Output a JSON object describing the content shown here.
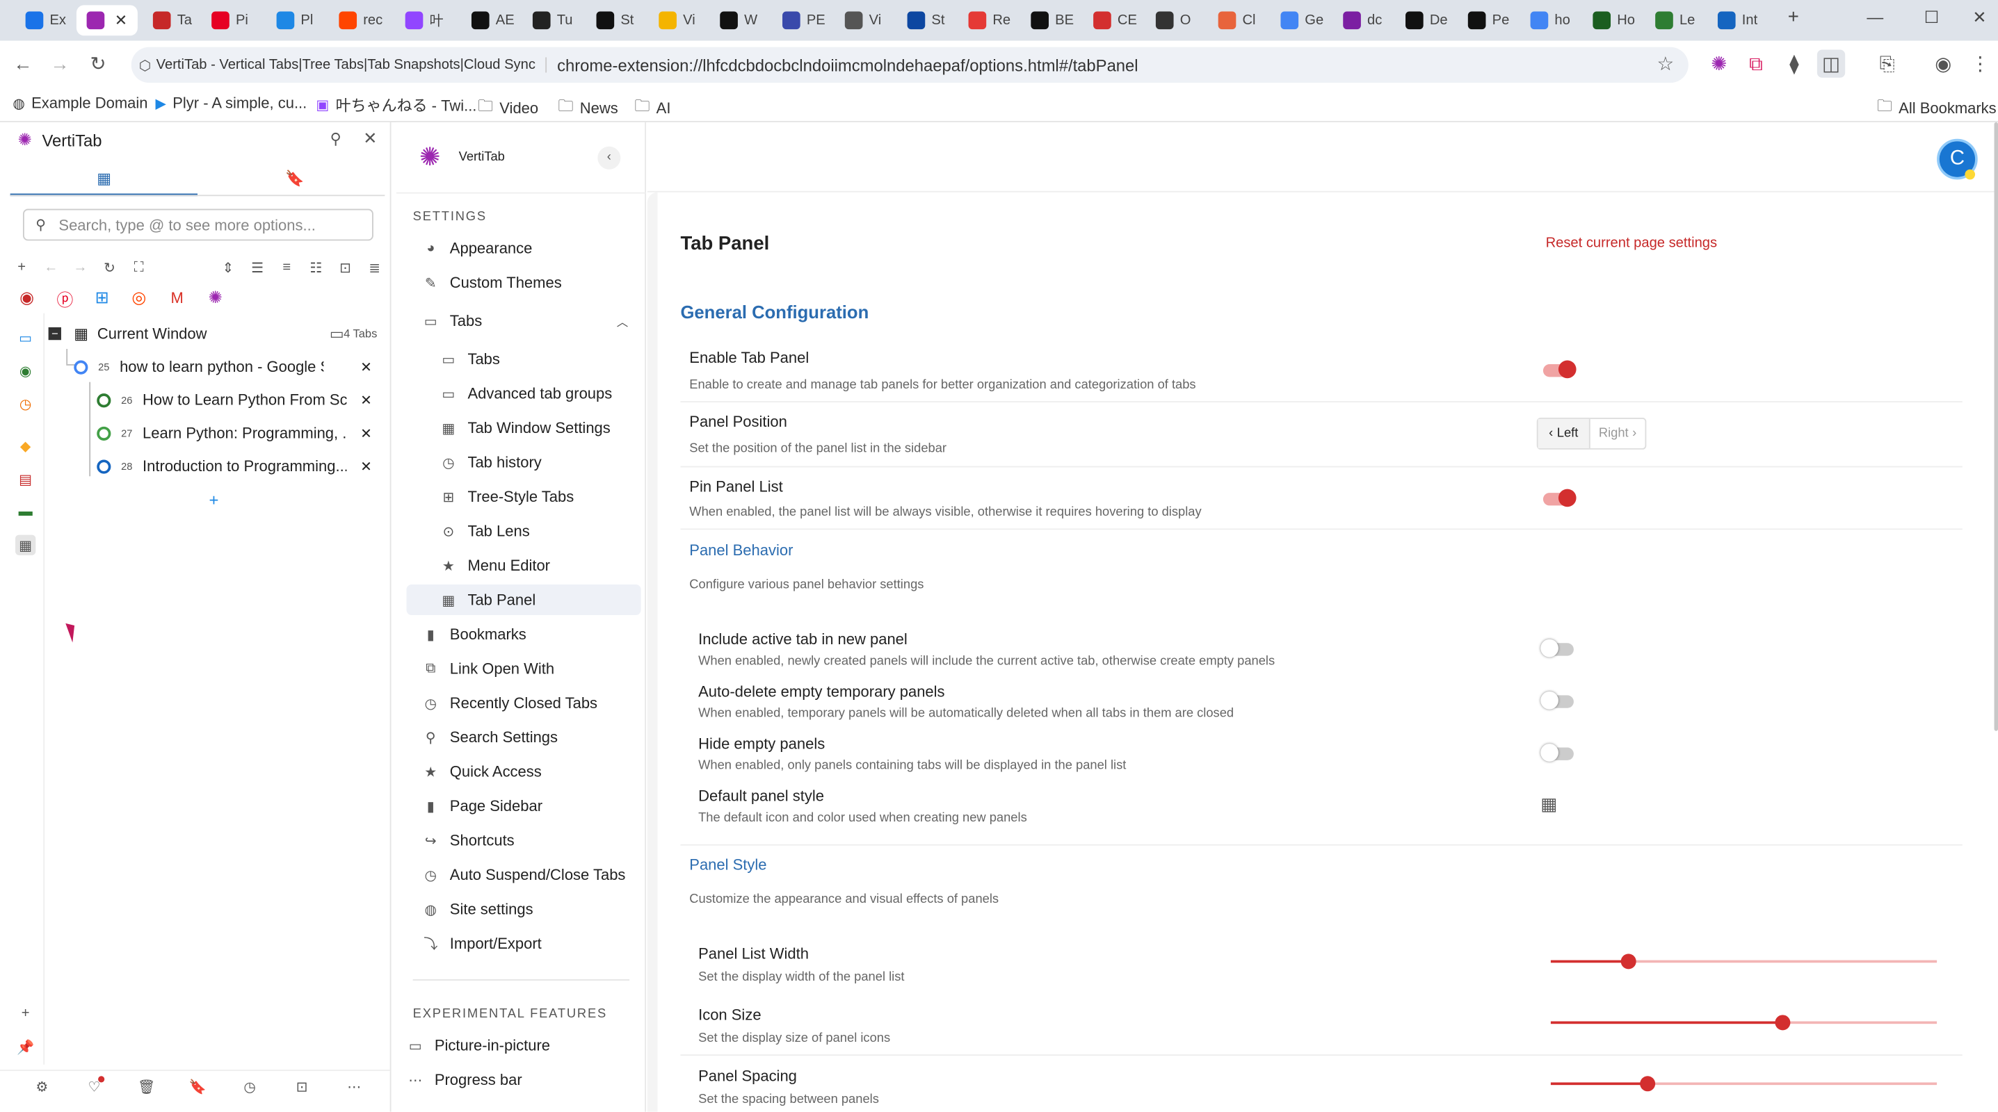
{
  "browser": {
    "tabs": [
      {
        "title": "Ex",
        "color": "#1a73e8"
      },
      {
        "title": "",
        "color": "#9c27b0",
        "active": true
      },
      {
        "title": "Ta",
        "color": "#c62828"
      },
      {
        "title": "Pi",
        "color": "#e60023"
      },
      {
        "title": "Pl",
        "color": "#1e88e5"
      },
      {
        "title": "rec",
        "color": "#ff4500"
      },
      {
        "title": "叶",
        "color": "#9146ff"
      },
      {
        "title": "AE",
        "color": "#111"
      },
      {
        "title": "Tu",
        "color": "#222"
      },
      {
        "title": "St",
        "color": "#111"
      },
      {
        "title": "Vi",
        "color": "#f4b400"
      },
      {
        "title": "W",
        "color": "#111"
      },
      {
        "title": "PE",
        "color": "#3949ab"
      },
      {
        "title": "Vi",
        "color": "#555"
      },
      {
        "title": "St",
        "color": "#0d47a1"
      },
      {
        "title": "Re",
        "color": "#e53935"
      },
      {
        "title": "BE",
        "color": "#111"
      },
      {
        "title": "CE",
        "color": "#d32f2f"
      },
      {
        "title": "O",
        "color": "#333"
      },
      {
        "title": "Cl",
        "color": "#e8643c"
      },
      {
        "title": "Ge",
        "color": "#4285f4"
      },
      {
        "title": "dc",
        "color": "#7b1fa2"
      },
      {
        "title": "De",
        "color": "#111"
      },
      {
        "title": "Pe",
        "color": "#111"
      },
      {
        "title": "ho",
        "color": "#4285f4"
      },
      {
        "title": "Ho",
        "color": "#1b5e20"
      },
      {
        "title": "Le",
        "color": "#2e7d32"
      },
      {
        "title": "Int",
        "color": "#1565c0"
      }
    ],
    "omnibox": {
      "site_chip": "VertiTab - Vertical Tabs|Tree Tabs|Tab Snapshots|Cloud Sync",
      "url": "chrome-extension://lhfcdcbdocbclndoiimcmolndehaepaf/options.html#/tabPanel"
    },
    "bookmarks": [
      "Example Domain",
      "Plyr - A simple, cu...",
      "叶ちゃんねる - Twi...",
      "Video",
      "News",
      "AI"
    ],
    "all_bookmarks": "All Bookmarks"
  },
  "sidepanel": {
    "title": "VertiTab",
    "search_placeholder": "Search, type @ to see more options...",
    "window_label": "Current Window",
    "tab_count": "4 Tabs",
    "tabs": [
      {
        "num": "25",
        "title": "how to learn python - Google Se...",
        "icon_color": "#4285f4"
      },
      {
        "num": "26",
        "title": "How to Learn Python From Sc...",
        "icon_color": "#2e7d32"
      },
      {
        "num": "27",
        "title": "Learn Python: Programming, ...",
        "icon_color": "#43a047"
      },
      {
        "num": "28",
        "title": "Introduction to Programming...",
        "icon_color": "#1565c0"
      }
    ],
    "add_label": "+"
  },
  "nav": {
    "brand": "VertiTab",
    "settings_header": "SETTINGS",
    "items": [
      "Appearance",
      "Custom Themes",
      "Tabs",
      "Tabs",
      "Advanced tab groups",
      "Tab Window Settings",
      "Tab history",
      "Tree-Style Tabs",
      "Tab Lens",
      "Menu Editor",
      "Tab Panel",
      "Bookmarks",
      "Link Open With",
      "Recently Closed Tabs",
      "Search Settings",
      "Quick Access",
      "Page Sidebar",
      "Shortcuts",
      "Auto Suspend/Close Tabs",
      "Site settings",
      "Import/Export"
    ],
    "experimental_header": "EXPERIMENTAL FEATURES",
    "experimental": [
      "Picture-in-picture",
      "Progress bar"
    ]
  },
  "main": {
    "avatar": "C",
    "title": "Tab Panel",
    "reset": "Reset current page settings",
    "general": "General Configuration",
    "enable_label": "Enable Tab Panel",
    "enable_desc": "Enable to create and manage tab panels for better organization and categorization of tabs",
    "enable_on": true,
    "position_label": "Panel Position",
    "position_desc": "Set the position of the panel list in the sidebar",
    "pos_left": "Left",
    "pos_right": "Right",
    "pos_selected": "Left",
    "pin_label": "Pin Panel List",
    "pin_desc": "When enabled, the panel list will be always visible, otherwise it requires hovering to display",
    "pin_on": true,
    "behavior": "Panel Behavior",
    "behavior_desc": "Configure various panel behavior settings",
    "include_label": "Include active tab in new panel",
    "include_desc": "When enabled, newly created panels will include the current active tab, otherwise create empty panels",
    "include_on": false,
    "autodel_label": "Auto-delete empty temporary panels",
    "autodel_desc": "When enabled, temporary panels will be automatically deleted when all tabs in them are closed",
    "autodel_on": false,
    "hide_label": "Hide empty panels",
    "hide_desc": "When enabled, only panels containing tabs will be displayed in the panel list",
    "hide_on": false,
    "default_style_label": "Default panel style",
    "default_style_desc": "The default icon and color used when creating new panels",
    "style": "Panel Style",
    "style_desc": "Customize the appearance and visual effects of panels",
    "width_label": "Panel List Width",
    "width_desc": "Set the display width of the panel list",
    "width_value": 0.2,
    "icon_label": "Icon Size",
    "icon_desc": "Set the display size of panel icons",
    "icon_value": 0.6,
    "spacing_label": "Panel Spacing",
    "spacing_desc": "Set the spacing between panels",
    "spacing_value": 0.25
  },
  "colors": {
    "accent": "#d32f2f",
    "link": "#2b6cb0",
    "reset": "#c62828"
  }
}
